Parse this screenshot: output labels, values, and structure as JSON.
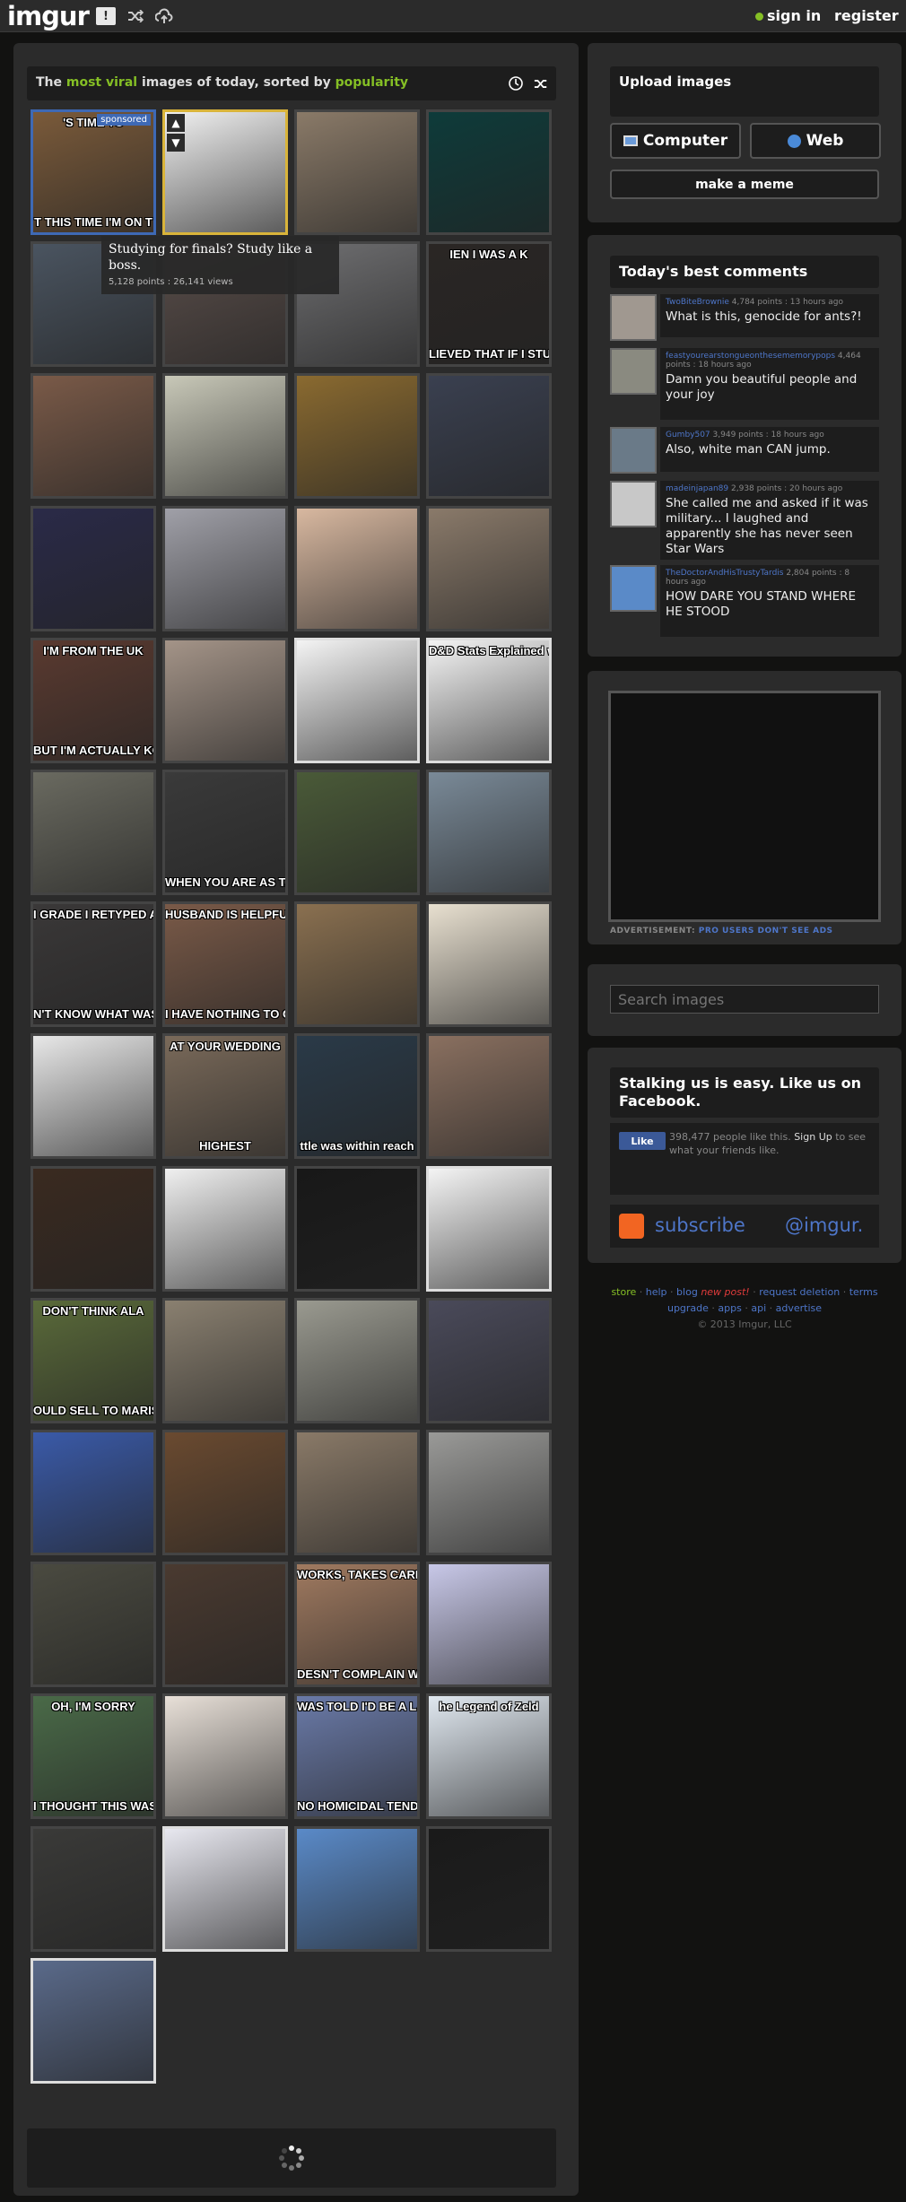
{
  "topbar": {
    "logo": "imgur",
    "gallery_icon": "!",
    "signin": "sign in",
    "register": "register"
  },
  "gallery": {
    "header": {
      "prefix": "The ",
      "viral": "most viral",
      "middle": " images of today, sorted by ",
      "sort": "popularity"
    },
    "sponsored": "sponsored",
    "hover": {
      "title": "Studying for finals? Study like a boss.",
      "meta": "5,128 points : 26,141 views"
    },
    "tiles": [
      {
        "bg": "#7a5a3a",
        "top": "'S TIME TO ",
        "bot": "T THIS TIME I'M ON T"
      },
      {
        "bg": "#f0f0f0",
        "top": "",
        "bot": ""
      },
      {
        "bg": "#8a7a68",
        "top": "",
        "bot": ""
      },
      {
        "bg": "#0e3b3a",
        "top": "",
        "bot": ""
      },
      {
        "bg": "#4a5460",
        "top": "",
        "bot": ""
      },
      {
        "bg": "#5a4e4a",
        "top": "",
        "bot": ""
      },
      {
        "bg": "#6e6e70",
        "top": "",
        "bot": ""
      },
      {
        "bg": "#2a2624",
        "top": "IEN I WAS A K",
        "bot": "LIEVED THAT IF I STUDIED HARD"
      },
      {
        "bg": "#7a5a48",
        "top": "",
        "bot": ""
      },
      {
        "bg": "#c8c8b8",
        "top": "",
        "bot": ""
      },
      {
        "bg": "#8a6a30",
        "top": "",
        "bot": ""
      },
      {
        "bg": "#3a4050",
        "top": "",
        "bot": ""
      },
      {
        "bg": "#2a2a48",
        "top": "",
        "bot": ""
      },
      {
        "bg": "#a0a0a8",
        "top": "",
        "bot": ""
      },
      {
        "bg": "#d8b8a0",
        "top": "",
        "bot": ""
      },
      {
        "bg": "#8a7a6a",
        "top": "",
        "bot": ""
      },
      {
        "bg": "#5a3a30",
        "top": "I'M FROM THE UK",
        "bot": "BUT I'M ACTUALLY KOREAN"
      },
      {
        "bg": "#a49488",
        "top": "",
        "bot": ""
      },
      {
        "bg": "#f4f4f4",
        "top": "",
        "bot": ""
      },
      {
        "bg": "#f4f4f4",
        "top": "D&D Stats Explained with Tomatoes",
        "bot": ""
      },
      {
        "bg": "#6a6a60",
        "top": "",
        "bot": ""
      },
      {
        "bg": "#3a3a3a",
        "top": "",
        "bot": "WHEN YOU ARE AS TALL AS"
      },
      {
        "bg": "#4a5a38",
        "top": "",
        "bot": ""
      },
      {
        "bg": "#7a8a98",
        "top": "",
        "bot": ""
      },
      {
        "bg": "#3a3838",
        "top": "I GRADE I RETYPED AN ENTIRE PAPER",
        "bot": "N'T KNOW WHAT WAS HAPPE"
      },
      {
        "bg": "#7a5a48",
        "top": "HUSBAND IS HELPFUL AROUN",
        "bot": "I HAVE NOTHING TO CONTRIBUTE"
      },
      {
        "bg": "#8a7050",
        "top": "",
        "bot": ""
      },
      {
        "bg": "#e8e0d0",
        "top": "",
        "bot": ""
      },
      {
        "bg": "#e8e8e8",
        "top": "",
        "bot": ""
      },
      {
        "bg": "#7a6a5a",
        "top": "AT YOUR WEDDING",
        "bot": "HIGHEST"
      },
      {
        "bg": "#2a3a48",
        "top": "",
        "bot": "ttle was within reach"
      },
      {
        "bg": "#8a7060",
        "top": "",
        "bot": ""
      },
      {
        "bg": "#3a2a20",
        "top": "",
        "bot": ""
      },
      {
        "bg": "#f0f0f0",
        "top": "",
        "bot": ""
      },
      {
        "bg": "#181818",
        "top": "",
        "bot": ""
      },
      {
        "bg": "#f4f4f4",
        "top": "",
        "bot": ""
      },
      {
        "bg": "#5a6a3a",
        "top": "DON'T THINK ALA",
        "bot": "OULD SELL TO MARIS"
      },
      {
        "bg": "#8a8070",
        "top": "",
        "bot": ""
      },
      {
        "bg": "#9a9a90",
        "top": "",
        "bot": ""
      },
      {
        "bg": "#4a4a5a",
        "top": "",
        "bot": ""
      },
      {
        "bg": "#3a5aa8",
        "top": "",
        "bot": ""
      },
      {
        "bg": "#6a4a30",
        "top": "",
        "bot": ""
      },
      {
        "bg": "#8a7a68",
        "top": "",
        "bot": ""
      },
      {
        "bg": "#9a9a98",
        "top": "",
        "bot": ""
      },
      {
        "bg": "#4a4a40",
        "top": "",
        "bot": ""
      },
      {
        "bg": "#4a3a30",
        "top": "",
        "bot": ""
      },
      {
        "bg": "#a07a60",
        "top": "WORKS, TAKES CARE OF PARENTS",
        "bot": "DESN'T COMPLAIN WHEN SON TAKES"
      },
      {
        "bg": "#c8c8e8",
        "top": "",
        "bot": ""
      },
      {
        "bg": "#4a6a48",
        "top": "OH, I'M SORRY",
        "bot": "I THOUGHT THIS WAS ALGEBRA"
      },
      {
        "bg": "#e8e0d8",
        "top": "",
        "bot": ""
      },
      {
        "bg": "#6a7aa8",
        "top": "WAS TOLD I'D BE A LADY",
        "bot": "NO HOMICIDAL TENDENCIES"
      },
      {
        "bg": "#e0e8f0",
        "top": "he Legend of Zeld",
        "bot": ""
      },
      {
        "bg": "#3a3a38",
        "top": "",
        "bot": ""
      },
      {
        "bg": "#e8e8f0",
        "top": "",
        "bot": ""
      },
      {
        "bg": "#5a8ac8",
        "top": "",
        "bot": ""
      },
      {
        "bg": "#1a1a1a",
        "top": "",
        "bot": ""
      },
      {
        "bg": "#5a6a8a",
        "top": "",
        "bot": ""
      }
    ]
  },
  "sidebar": {
    "upload_title": "Upload images",
    "computer": "Computer",
    "web": "Web",
    "meme": "make a meme",
    "comments_title": "Today's best comments",
    "comments": [
      {
        "user": "TwoBiteBrownie",
        "meta": " 4,784 points : 13 hours ago",
        "text": "What is this, genocide for ants?!"
      },
      {
        "user": "feastyourearstongueonthesememorypops",
        "meta": " 4,464 points : 18 hours ago",
        "text": "Damn you beautiful people and your joy"
      },
      {
        "user": "Gumby507",
        "meta": " 3,949 points : 18 hours ago",
        "text": "Also, white man CAN jump."
      },
      {
        "user": "madeinjapan89",
        "meta": " 2,938 points : 20 hours ago",
        "text": "She called me and asked if it was military... I laughed and apparently she has never seen Star Wars"
      },
      {
        "user": "TheDoctorAndHisTrustyTardis",
        "meta": " 2,804 points : 8 hours ago",
        "text": "HOW DARE YOU STAND WHERE HE STOOD"
      }
    ],
    "ad_label": "ADVERTISEMENT: ",
    "ad_pro": "PRO USERS DON'T SEE ADS",
    "search_placeholder": "Search images",
    "social_title": "Stalking us is easy. Like us on Facebook.",
    "fb_like": "Like",
    "fb_count": "398,477 people like this.",
    "fb_signup": "Sign Up",
    "fb_rest": " to see what your friends like.",
    "subscribe": "subscribe",
    "twitter": "@imgur.",
    "footer": {
      "store": "store",
      "help": "help",
      "blog": "blog",
      "new_post": "new post!",
      "request_deletion": "request deletion",
      "terms": "terms",
      "upgrade": "upgrade",
      "apps": "apps",
      "api": "api",
      "advertise": "advertise",
      "copyright": "© 2013 Imgur, LLC"
    }
  }
}
